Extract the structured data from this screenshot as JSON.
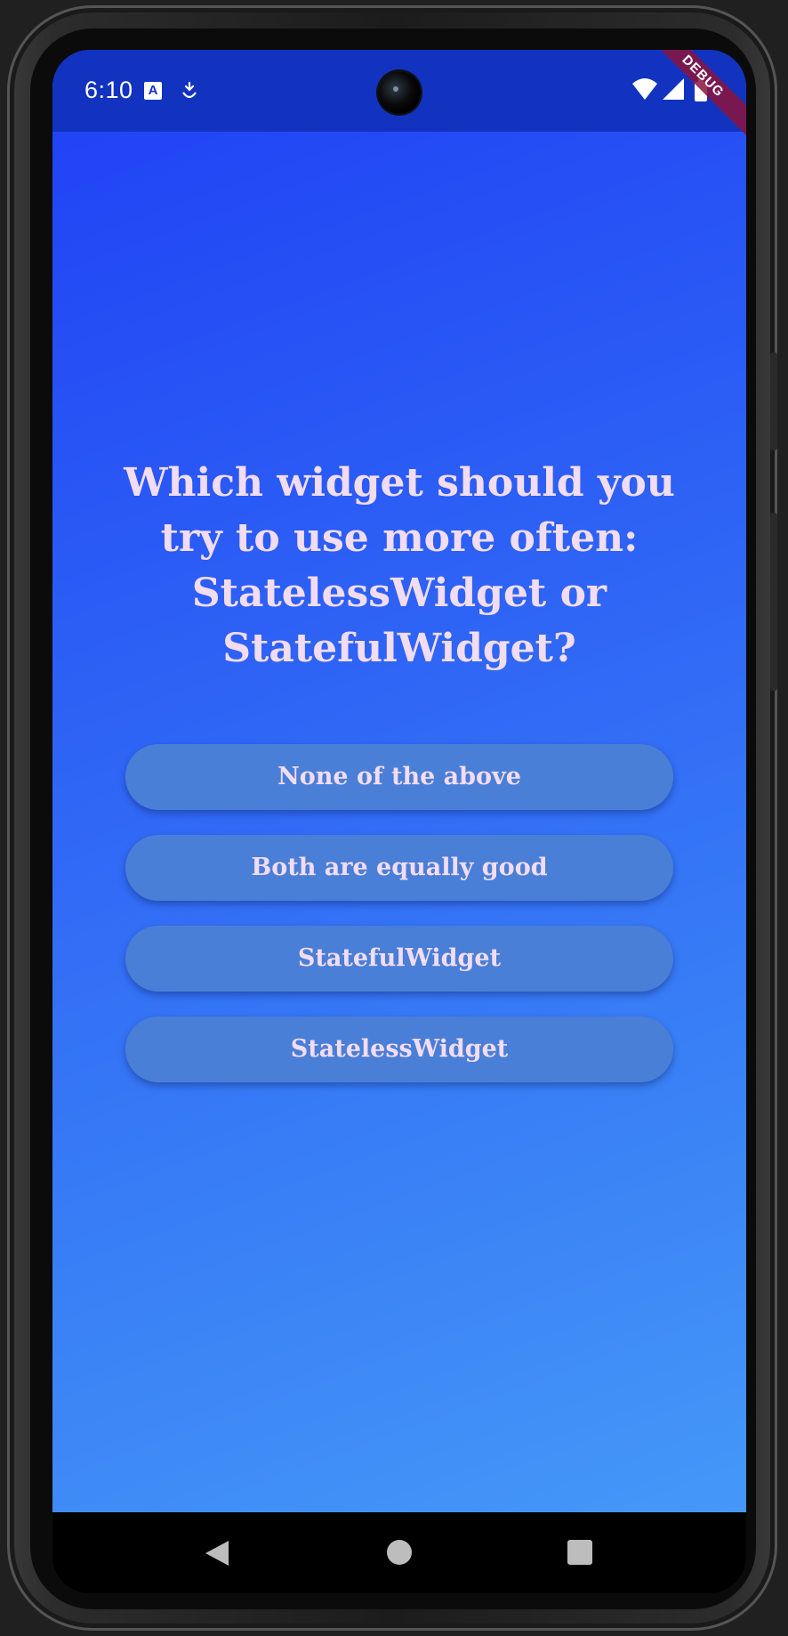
{
  "status_bar": {
    "time": "6:10",
    "icons": [
      "font-a-icon",
      "download-badge-icon",
      "wifi-icon",
      "cell-signal-icon",
      "battery-icon"
    ]
  },
  "debug_banner": "DEBUG",
  "question": "Which widget should you try to use more often: StatelessWidget or StatefulWidget?",
  "answers": [
    "None of the above",
    "Both are equally good",
    "StatefulWidget",
    "StatelessWidget"
  ],
  "nav_bar": {
    "icons": [
      "back-icon",
      "home-icon",
      "recents-icon"
    ]
  },
  "colors": {
    "status_bar": "#1233bf",
    "gradient_start": "#1f3ff5",
    "gradient_end": "#4598f8",
    "button": "#4a7fd8",
    "text": "#f2dcf2"
  }
}
